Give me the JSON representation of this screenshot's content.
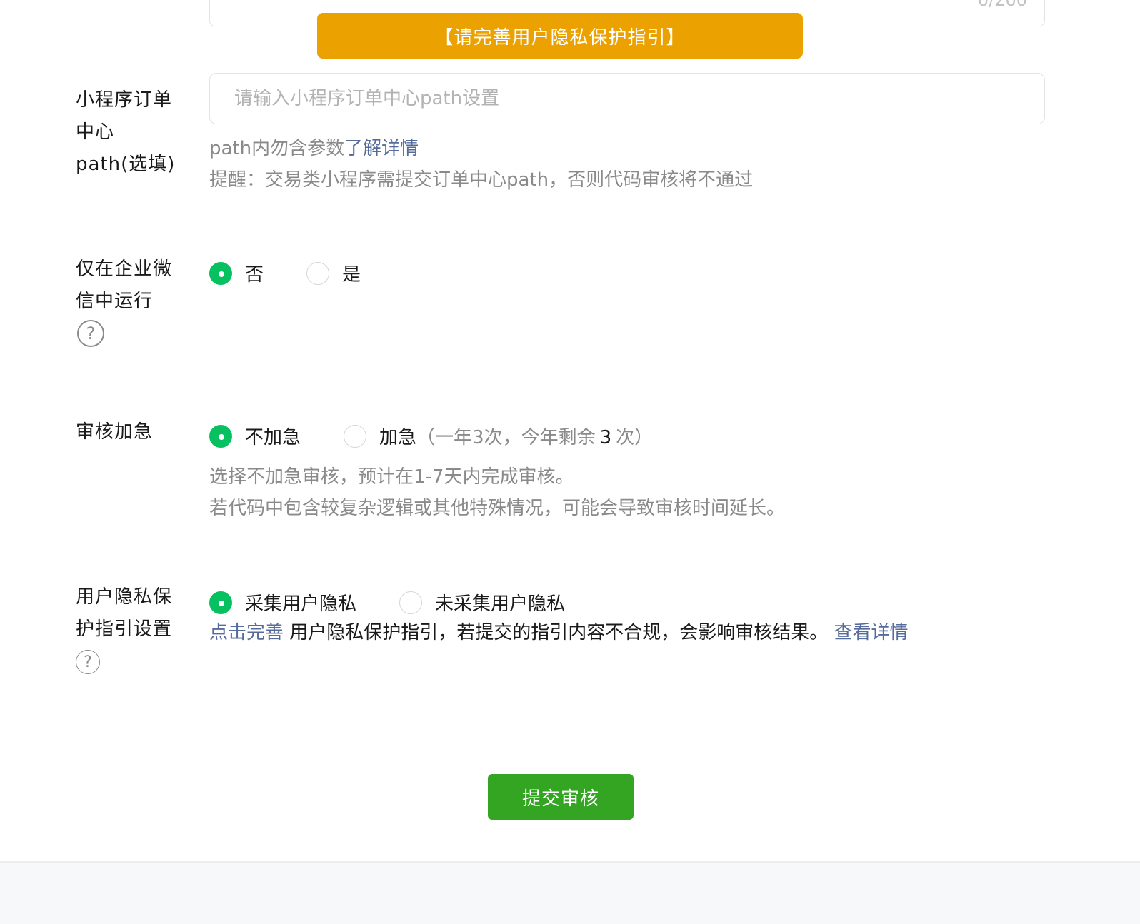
{
  "top_textarea": {
    "counter": "0/200"
  },
  "toast": {
    "text": "【请完善用户隐私保护指引】"
  },
  "order_path": {
    "label": "小程序订单中心path(选填)",
    "placeholder": "请输入小程序订单中心path设置",
    "hint_prefix": "path内勿含参数",
    "hint_link": "了解详情",
    "reminder": "提醒：交易类小程序需提交订单中心path，否则代码审核将不通过"
  },
  "wecom_only": {
    "label": "仅在企业微信中运行",
    "help_icon": "question-circle-icon",
    "options": [
      {
        "label": "否",
        "checked": true
      },
      {
        "label": "是",
        "checked": false
      }
    ]
  },
  "expedite": {
    "label": "审核加急",
    "options": [
      {
        "label": "不加急",
        "checked": true
      },
      {
        "label": "加急",
        "checked": false
      }
    ],
    "expedite_note_prefix": "（一年3次，今年剩余",
    "remaining": "3",
    "expedite_note_suffix": "次）",
    "desc_line1": "选择不加急审核，预计在1-7天内完成审核。",
    "desc_line2": "若代码中包含较复杂逻辑或其他特殊情况，可能会导致审核时间延长。"
  },
  "privacy": {
    "label": "用户隐私保护指引设置",
    "help_icon": "question-circle-icon",
    "options": [
      {
        "label": "采集用户隐私",
        "checked": true
      },
      {
        "label": "未采集用户隐私",
        "checked": false
      }
    ],
    "complete_link": "点击完善",
    "desc": " 用户隐私保护指引，若提交的指引内容不合规，会影响审核结果。 ",
    "details_link": "查看详情"
  },
  "submit": {
    "label": "提交审核"
  },
  "colors": {
    "accent_green": "#07c160",
    "button_green": "#34a523",
    "toast_orange": "#eba201",
    "link_blue": "#556b9c"
  }
}
